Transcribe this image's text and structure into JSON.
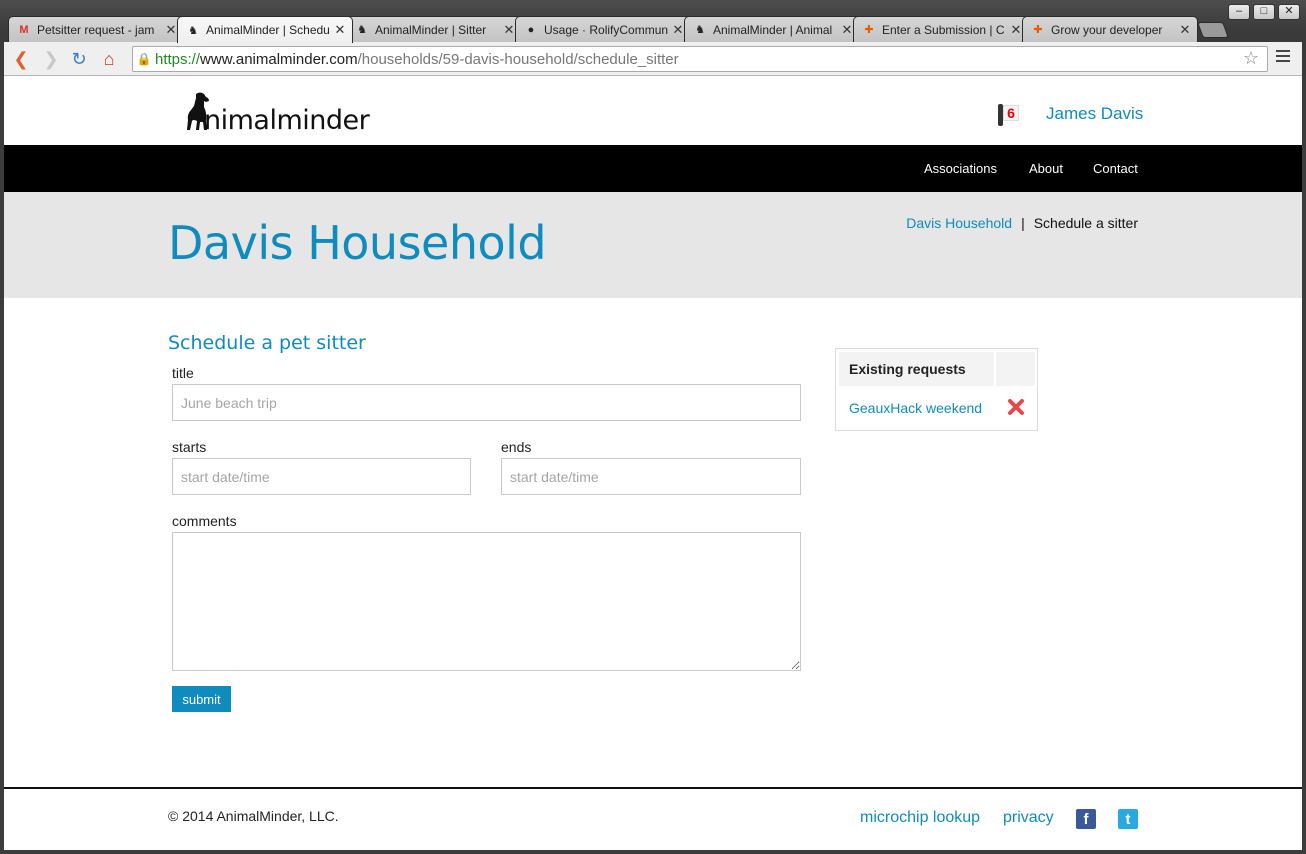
{
  "browser": {
    "tabs": [
      {
        "title": "Petsitter request - jam",
        "favicon": "gmail-icon"
      },
      {
        "title": "AnimalMinder | Schedule",
        "favicon": "animalminder-icon",
        "active": true
      },
      {
        "title": "AnimalMinder | Sitter",
        "favicon": "animalminder-icon"
      },
      {
        "title": "Usage · RolifyCommunity",
        "favicon": "github-icon"
      },
      {
        "title": "AnimalMinder | Animal",
        "favicon": "animalminder-icon"
      },
      {
        "title": "Enter a Submission | C",
        "favicon": "puzzle-icon"
      },
      {
        "title": "Grow your developer",
        "favicon": "puzzle-icon"
      }
    ],
    "url": {
      "scheme": "https://",
      "host": "www.animalminder.com",
      "path": "/households/59-davis-household/schedule_sitter"
    }
  },
  "header": {
    "logo_text": "nimalminder",
    "notification_count": "6",
    "user_name": "James Davis"
  },
  "nav": {
    "items": [
      "Associations",
      "About",
      "Contact"
    ]
  },
  "hero": {
    "title": "Davis Household",
    "breadcrumb": {
      "parent": "Davis Household",
      "separator": "|",
      "current": "Schedule a sitter"
    }
  },
  "form": {
    "heading": "Schedule a pet sitter",
    "title_label": "title",
    "title_placeholder": "June beach trip",
    "starts_label": "starts",
    "starts_placeholder": "start date/time",
    "ends_label": "ends",
    "ends_placeholder": "start date/time",
    "comments_label": "comments",
    "comments_value": "",
    "submit_label": "submit"
  },
  "requests": {
    "heading": "Existing requests",
    "items": [
      {
        "name": "GeauxHack weekend"
      }
    ]
  },
  "footer": {
    "copyright": "© 2014 AnimalMinder, LLC.",
    "links": [
      "microchip lookup",
      "privacy"
    ]
  },
  "colors": {
    "brand": "#0f8bbd",
    "navbar": "#000000",
    "hero_bg": "#e6e6e6",
    "delete": "#e8474b"
  }
}
